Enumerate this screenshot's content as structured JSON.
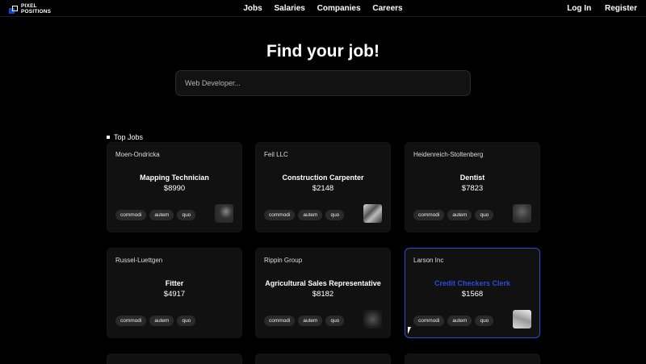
{
  "header": {
    "logo_text": "PIXEL\nPOSITIONS",
    "nav": [
      "Jobs",
      "Salaries",
      "Companies",
      "Careers"
    ],
    "login": "Log In",
    "register": "Register"
  },
  "hero": {
    "title": "Find your job!",
    "search_placeholder": "Web Developer..."
  },
  "top_jobs": {
    "title": "Top Jobs",
    "cards": [
      {
        "company": "Moen-Ondricka",
        "title": "Mapping Technician",
        "salary": "$8990",
        "tags": [
          "commodi",
          "autem",
          "quo"
        ]
      },
      {
        "company": "Feil LLC",
        "title": "Construction Carpenter",
        "salary": "$2148",
        "tags": [
          "commodi",
          "autem",
          "quo"
        ]
      },
      {
        "company": "Heidenreich-Stoltenberg",
        "title": "Dentist",
        "salary": "$7823",
        "tags": [
          "commodi",
          "autem",
          "quo"
        ]
      },
      {
        "company": "Russel-Luettgen",
        "title": "Fitter",
        "salary": "$4917",
        "tags": [
          "commodi",
          "autem",
          "quo"
        ]
      },
      {
        "company": "Rippin Group",
        "title": "Agricultural Sales Representative",
        "salary": "$8182",
        "tags": [
          "commodi",
          "autem",
          "quo"
        ]
      },
      {
        "company": "Larson Inc",
        "title": "Credit Checkers Clerk",
        "salary": "$1568",
        "tags": [
          "commodi",
          "autem",
          "quo"
        ]
      }
    ]
  },
  "colors": {
    "accent": "#2b4bd9",
    "background": "#000000",
    "card": "#111111"
  }
}
